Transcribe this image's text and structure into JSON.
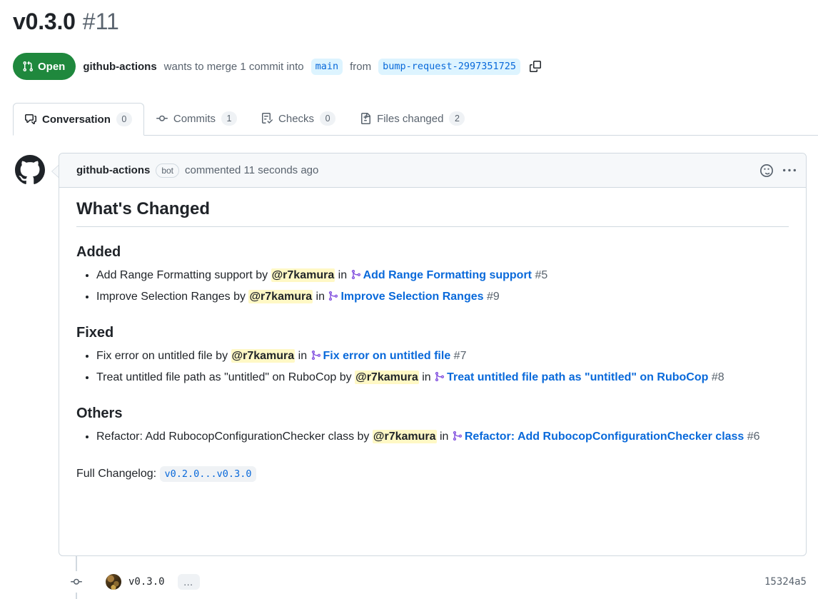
{
  "header": {
    "title": "v0.3.0",
    "number": "#11",
    "state": "Open",
    "state_color": "#1f883d",
    "author": "github-actions",
    "merge_text": "wants to merge 1 commit into",
    "base_branch": "main",
    "from_text": "from",
    "head_branch": "bump-request-2997351725",
    "copy_icon": "copy-icon",
    "state_icon": "git-pull-request-icon"
  },
  "tabs": [
    {
      "label": "Conversation",
      "count": "0",
      "icon": "comment-discussion-icon",
      "active": true
    },
    {
      "label": "Commits",
      "count": "1",
      "icon": "git-commit-icon",
      "active": false
    },
    {
      "label": "Checks",
      "count": "0",
      "icon": "checklist-icon",
      "active": false
    },
    {
      "label": "Files changed",
      "count": "2",
      "icon": "file-diff-icon",
      "active": false
    }
  ],
  "comment": {
    "avatar_icon": "github-octocat-avatar",
    "user": "github-actions",
    "bot_label": "bot",
    "commented_text": "commented 11 seconds ago",
    "reaction_icon": "smiley-icon",
    "menu_icon": "kebab-horizontal-icon",
    "heading": "What's Changed",
    "sections": [
      {
        "title": "Added",
        "items": [
          {
            "text_before": "Add Range Formatting support by ",
            "mention": "@r7kamura",
            "in_text": " in ",
            "link_icon": "git-merge-icon",
            "link": "Add Range Formatting support",
            "number": "#5"
          },
          {
            "text_before": "Improve Selection Ranges by ",
            "mention": "@r7kamura",
            "in_text": " in ",
            "link_icon": "git-merge-icon",
            "link": "Improve Selection Ranges",
            "number": "#9"
          }
        ]
      },
      {
        "title": "Fixed",
        "items": [
          {
            "text_before": "Fix error on untitled file by ",
            "mention": "@r7kamura",
            "in_text": " in ",
            "link_icon": "git-merge-icon",
            "link": "Fix error on untitled file",
            "number": "#7"
          },
          {
            "text_before": "Treat untitled file path as \"untitled\" on RuboCop by ",
            "mention": "@r7kamura",
            "in_text": " in ",
            "link_icon": "git-merge-icon",
            "link": "Treat untitled file path as \"untitled\" on RuboCop",
            "number": "#8"
          }
        ]
      },
      {
        "title": "Others",
        "items": [
          {
            "text_before": "Refactor: Add RubocopConfigurationChecker class by ",
            "mention": "@r7kamura",
            "in_text": " in ",
            "link_icon": "git-merge-icon",
            "link": "Refactor: Add RubocopConfigurationChecker class",
            "number": "#6"
          }
        ]
      }
    ],
    "changelog_label": "Full Changelog:",
    "changelog_range": "v0.2.0...v0.3.0"
  },
  "timeline": {
    "commit_icon": "git-commit-dot-icon",
    "avatar": "user-avatar",
    "message": "v0.3.0",
    "more_label": "…",
    "sha": "15324a5"
  },
  "colors": {
    "green": "#1f883d",
    "blue_link": "#0969da",
    "purple_merge": "#8250df",
    "mention_highlight": "#fff8c5",
    "border": "#d1d9e0",
    "muted_text": "#59636e"
  }
}
